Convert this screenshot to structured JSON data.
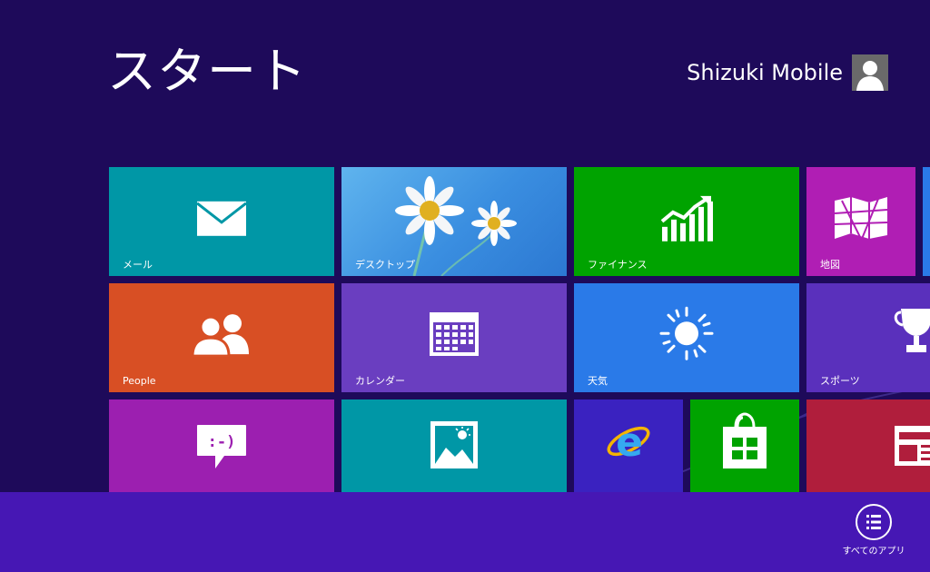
{
  "screen": {
    "title": "スタート"
  },
  "user": {
    "name": "Shizuki Mobile",
    "avatar_icon": "user-silhouette-icon"
  },
  "tiles": {
    "mail": {
      "label": "メール",
      "icon": "envelope-icon",
      "color": "#0097a6"
    },
    "desktop": {
      "label": "デスクトップ",
      "icon": "daisy-wallpaper",
      "color": "#3a8ee0"
    },
    "finance": {
      "label": "ファイナンス",
      "icon": "rising-chart-icon",
      "color": "#00a300"
    },
    "maps": {
      "label": "地図",
      "icon": "map-icon",
      "color": "#b01eb4"
    },
    "people": {
      "label": "People",
      "icon": "people-icon",
      "color": "#d84f24"
    },
    "calendar": {
      "label": "カレンダー",
      "icon": "calendar-icon",
      "color": "#6a3ec0"
    },
    "weather": {
      "label": "天気",
      "icon": "sun-icon",
      "color": "#2a7ae8"
    },
    "sports": {
      "label": "スポーツ",
      "icon": "trophy-icon",
      "color": "#5a30bc"
    },
    "messaging": {
      "label": "",
      "icon": "smiley-speech-bubble-icon",
      "color": "#9c1fb0"
    },
    "photos": {
      "label": "",
      "icon": "picture-icon",
      "color": "#0097a6"
    },
    "ie": {
      "label": "",
      "icon": "internet-explorer-icon",
      "color": "#3a22c0"
    },
    "store": {
      "label": "",
      "icon": "store-bag-icon",
      "color": "#00a300"
    },
    "news": {
      "label": "",
      "icon": "newspaper-icon",
      "color": "#b01e3c"
    }
  },
  "appbar": {
    "all_apps_label": "すべてのアプリ",
    "all_apps_icon": "list-circle-icon"
  }
}
